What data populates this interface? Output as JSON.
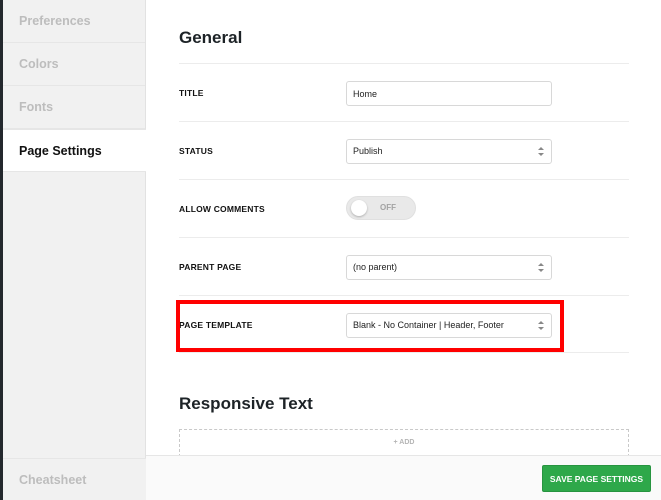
{
  "sidebar": {
    "items": [
      {
        "label": "Preferences"
      },
      {
        "label": "Colors"
      },
      {
        "label": "Fonts"
      },
      {
        "label": "Page Settings"
      }
    ],
    "bottom_label": "Cheatsheet"
  },
  "general": {
    "title": "General",
    "title_label": "TITLE",
    "title_value": "Home",
    "status_label": "STATUS",
    "status_value": "Publish",
    "comments_label": "ALLOW COMMENTS",
    "comments_toggle": "OFF",
    "parent_label": "PARENT PAGE",
    "parent_value": "(no parent)",
    "template_label": "PAGE TEMPLATE",
    "template_value": "Blank - No Container | Header, Footer"
  },
  "responsive": {
    "title": "Responsive Text",
    "add_label": "+ ADD"
  },
  "footer": {
    "save_label": "SAVE PAGE SETTINGS"
  },
  "colors": {
    "highlight": "#ff0000",
    "save_button": "#2ea84a"
  }
}
